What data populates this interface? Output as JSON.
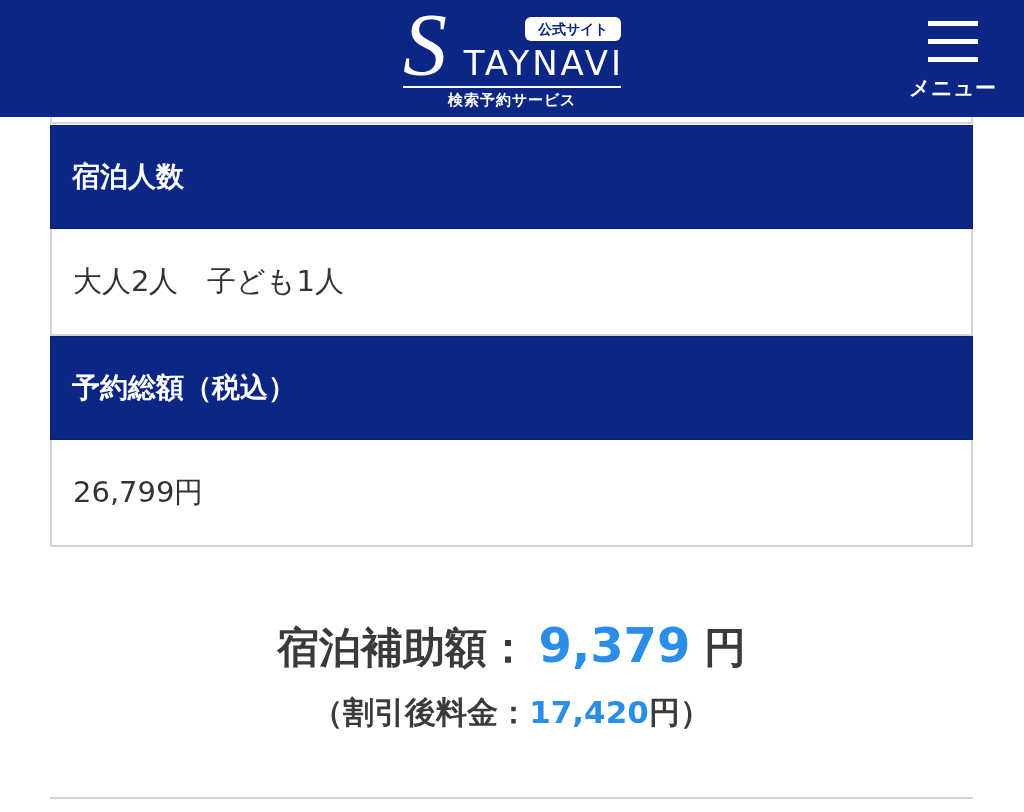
{
  "header": {
    "logo": {
      "initial": "S",
      "wordmark": "TAYNAVI"
    },
    "badge": "公式サイト",
    "tagline": "検索予約サービス",
    "menu": {
      "label": "メニュー"
    }
  },
  "details": [
    {
      "heading": "宿泊人数",
      "value": "大人2人　子ども1人"
    },
    {
      "heading": "予約総額（税込）",
      "value": "26,799円"
    }
  ],
  "subsidy": {
    "label": "宿泊補助額：",
    "amount": "9,379",
    "unit": "円"
  },
  "after_discount": {
    "prefix": "（割引後料金：",
    "amount": "17,420",
    "suffix": "円）"
  }
}
